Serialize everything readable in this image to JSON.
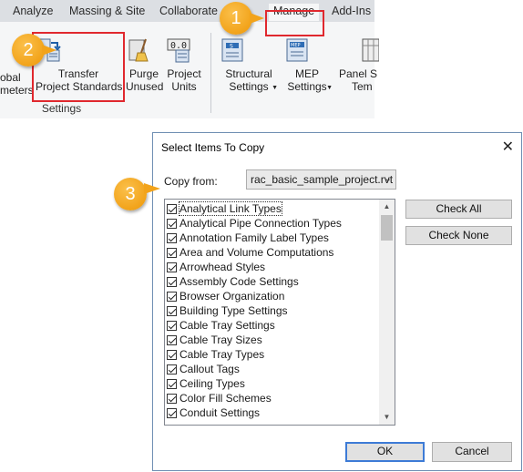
{
  "ribbon": {
    "tabs": [
      "Analyze",
      "Massing & Site",
      "Collaborate",
      "Manage",
      "Add-Ins"
    ],
    "buttons": {
      "global_params": [
        "obal",
        "meters"
      ],
      "transfer": [
        "Transfer",
        "Project Standards"
      ],
      "purge": [
        "Purge",
        "Unused"
      ],
      "units": [
        "Project",
        "Units"
      ],
      "structural": [
        "Structural",
        "Settings"
      ],
      "mep": [
        "MEP",
        "Settings"
      ],
      "panel": [
        "Panel S",
        "Tem"
      ]
    },
    "panel_label": "Settings"
  },
  "callouts": [
    "1",
    "2",
    "3"
  ],
  "dialog": {
    "title": "Select Items To Copy",
    "close": "✕",
    "copy_from_label": "Copy from:",
    "copy_from_value": "rac_basic_sample_project.rvt",
    "items": [
      "Analytical Link Types",
      "Analytical Pipe Connection Types",
      "Annotation Family Label Types",
      "Area and Volume Computations",
      "Arrowhead Styles",
      "Assembly Code Settings",
      "Browser Organization",
      "Building Type Settings",
      "Cable Tray Settings",
      "Cable Tray Sizes",
      "Cable Tray Types",
      "Callout Tags",
      "Ceiling Types",
      "Color Fill Schemes",
      "Conduit Settings"
    ],
    "check_all": "Check All",
    "check_none": "Check None",
    "ok": "OK",
    "cancel": "Cancel"
  },
  "colors": {
    "accent_red": "#e0282e",
    "callout": "#f2a31a",
    "focus_blue": "#3d7bd6"
  }
}
